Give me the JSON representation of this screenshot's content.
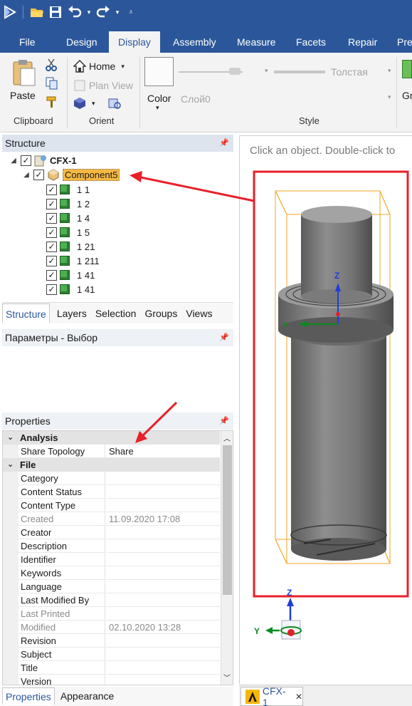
{
  "ribbon": {
    "tabs": [
      "File",
      "Design",
      "Display",
      "Assembly",
      "Measure",
      "Facets",
      "Repair",
      "Pre"
    ],
    "active_tab": "Display",
    "clipboard": {
      "paste": "Paste",
      "label": "Clipboard"
    },
    "orient": {
      "home": "Home",
      "plan_view": "Plan View",
      "label": "Orient"
    },
    "style": {
      "color": "Color",
      "layer": "Слой0",
      "thick": "Толстая",
      "label": "Style",
      "extra": "Gr"
    }
  },
  "structure": {
    "title": "Structure",
    "root": "CFX-1",
    "component": "Component5",
    "bodies": [
      "1 1",
      "1 2",
      "1 4",
      "1 5",
      "1 21",
      "1 211",
      "1 41",
      "1 41"
    ],
    "tabs": [
      "Structure",
      "Layers",
      "Selection",
      "Groups",
      "Views"
    ]
  },
  "options_pane": {
    "title": "Параметры - Выбор"
  },
  "properties": {
    "title": "Properties",
    "categories": [
      {
        "name": "Analysis",
        "rows": [
          {
            "k": "Share Topology",
            "v": "Share",
            "gray": false
          }
        ]
      },
      {
        "name": "File",
        "rows": [
          {
            "k": "Category",
            "v": "",
            "gray": false
          },
          {
            "k": "Content Status",
            "v": "",
            "gray": false
          },
          {
            "k": "Content Type",
            "v": "",
            "gray": false
          },
          {
            "k": "Created",
            "v": "11.09.2020 17:08",
            "gray": true
          },
          {
            "k": "Creator",
            "v": "",
            "gray": false
          },
          {
            "k": "Description",
            "v": "",
            "gray": false
          },
          {
            "k": "Identifier",
            "v": "",
            "gray": false
          },
          {
            "k": "Keywords",
            "v": "",
            "gray": false
          },
          {
            "k": "Language",
            "v": "",
            "gray": false
          },
          {
            "k": "Last Modified By",
            "v": "",
            "gray": false
          },
          {
            "k": "Last Printed",
            "v": "",
            "gray": true
          },
          {
            "k": "Modified",
            "v": "02.10.2020 13:28",
            "gray": true
          },
          {
            "k": "Revision",
            "v": "",
            "gray": false
          },
          {
            "k": "Subject",
            "v": "",
            "gray": false
          },
          {
            "k": "Title",
            "v": "",
            "gray": false
          },
          {
            "k": "Version",
            "v": "",
            "gray": false
          }
        ]
      }
    ],
    "tabs": [
      "Properties",
      "Appearance"
    ]
  },
  "viewport": {
    "hint": "Click an object. Double-click to",
    "axis_z": "Z",
    "axis_y": "Y",
    "doc_tab": "CFX-1",
    "highlight_color": "#e8202a",
    "bbox_color": "#f5a623"
  },
  "colors": {
    "ribbon_blue": "#2b579a",
    "selection": "#f5b942"
  }
}
